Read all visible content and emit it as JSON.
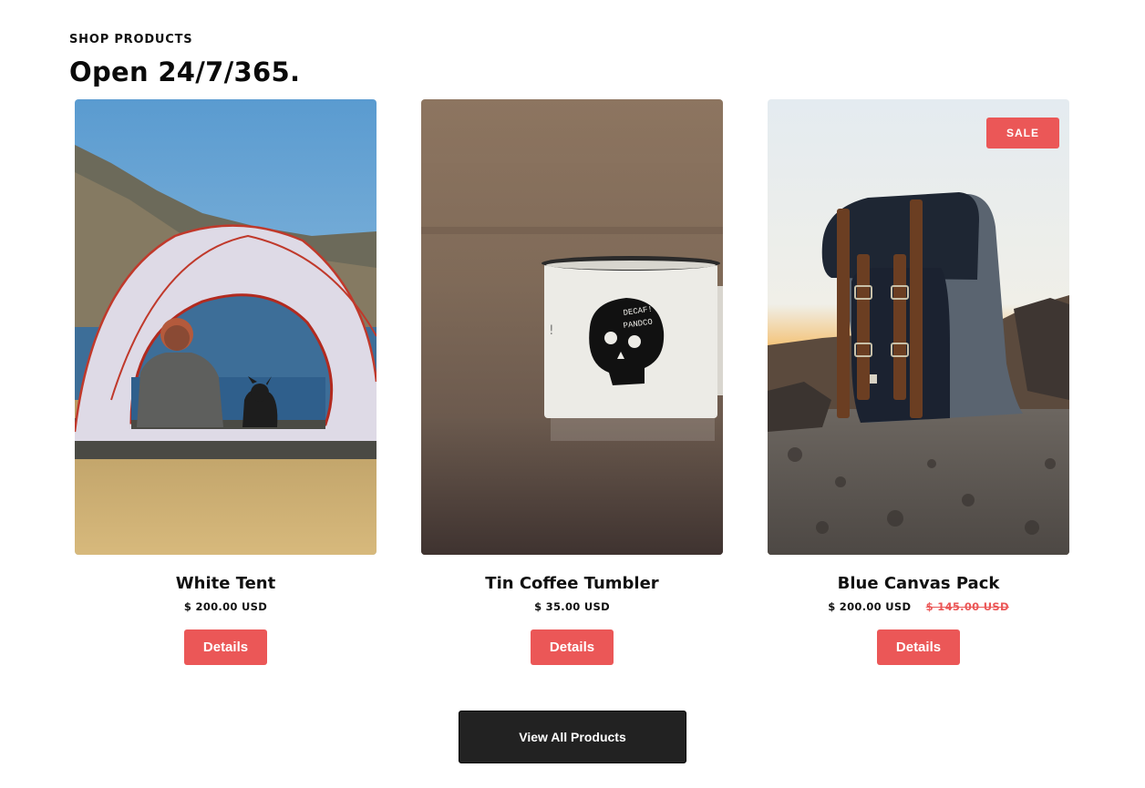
{
  "section": {
    "eyebrow": "SHOP PRODUCTS",
    "headline": "Open 24/7/365."
  },
  "products": [
    {
      "name": "White Tent",
      "price": "$ 200.00 USD",
      "compare_price": "",
      "badge": "",
      "button_label": "Details",
      "image": "tent-photo"
    },
    {
      "name": "Tin Coffee Tumbler",
      "price": "$ 35.00 USD",
      "compare_price": "",
      "badge": "",
      "button_label": "Details",
      "image": "mug-photo"
    },
    {
      "name": "Blue Canvas Pack",
      "price": "$ 200.00 USD",
      "compare_price": "$ 145.00 USD",
      "badge": "SALE",
      "button_label": "Details",
      "image": "backpack-photo"
    }
  ],
  "view_all_label": "View All Products",
  "mug_print": {
    "line1": "DECAF!",
    "line2": "PANDCO"
  },
  "colors": {
    "accent": "#eb5757",
    "dark_button": "#222222",
    "text": "#111111"
  }
}
